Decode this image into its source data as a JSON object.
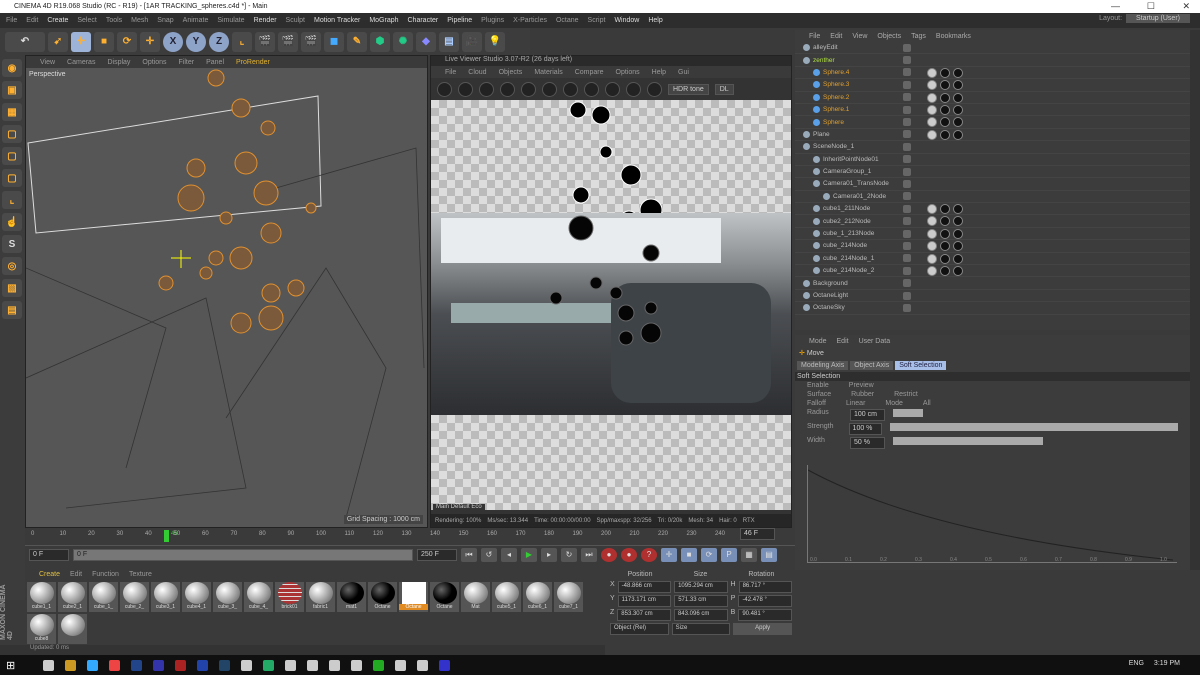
{
  "window": {
    "title": "CINEMA 4D R19.068 Studio (RC - R19) - [1AR TRACKING_spheres.c4d *] - Main",
    "min": "—",
    "max": "☐",
    "close": "✕"
  },
  "menu": [
    "File",
    "Edit",
    "Create",
    "Select",
    "Tools",
    "Mesh",
    "Snap",
    "Animate",
    "Simulate",
    "Render",
    "Sculpt",
    "Motion Tracker",
    "MoGraph",
    "Character",
    "Pipeline",
    "Plugins",
    "X-Particles",
    "Octane",
    "Script",
    "Window",
    "Help"
  ],
  "layout": {
    "label": "Layout:",
    "value": "Startup (User)"
  },
  "toolbar": {
    "x": "X",
    "y": "Y",
    "z": "Z"
  },
  "viewport": {
    "menu": [
      "View",
      "Cameras",
      "Display",
      "Options",
      "Filter",
      "Panel",
      "ProRender"
    ],
    "label": "Perspective",
    "grid_spacing": "Grid Spacing : 1000 cm"
  },
  "render_viewer": {
    "title": "Live Viewer Studio 3.07-R2 (26 days left)",
    "menu": [
      "File",
      "Cloud",
      "Objects",
      "Materials",
      "Compare",
      "Options",
      "Help",
      "Gui"
    ],
    "mode": "HDR tone",
    "channel": "DL",
    "tab": "Main Default Eco",
    "status": [
      "Rendering: 100%",
      "Ms/sec: 13.344",
      "Time: 00:00:00/00:00",
      "Spp/maxspp: 32/256",
      "Tri: 0/20k",
      "Mesh: 34",
      "Hair: 0",
      "RTX"
    ]
  },
  "timeline": {
    "ticks": [
      "0",
      "10",
      "20",
      "30",
      "40",
      "50",
      "60",
      "70",
      "80",
      "90",
      "100",
      "110",
      "120",
      "130",
      "140",
      "150",
      "160",
      "170",
      "180",
      "190",
      "200",
      "210",
      "220",
      "230",
      "240"
    ],
    "current": "46",
    "start": "0 F",
    "range_start": "0 F",
    "range_end": "250 F",
    "end": "250 F",
    "fps_field": "46 F"
  },
  "materials": {
    "menu": [
      "Create",
      "Edit",
      "Function",
      "Texture"
    ],
    "items": [
      "cube1_1",
      "cube2_1",
      "cube_1_",
      "cube_2_",
      "cube3_1",
      "cube4_1",
      "cube_3_",
      "cube_4_",
      "brick01",
      "fabric1",
      "mat1",
      "Octane",
      "Octane",
      "Octane",
      "Mat",
      "cube5_1",
      "cube6_1",
      "cube7_1",
      "cube8"
    ],
    "selected": 12
  },
  "brand": "MAXON CINEMA 4D",
  "coords": {
    "headers": [
      "Position",
      "Size",
      "Rotation"
    ],
    "rows": [
      {
        "axis": "X",
        "pos": "-48.866 cm",
        "size": "1095.294 cm",
        "rot_axis": "H",
        "rot": "86.717 °"
      },
      {
        "axis": "Y",
        "pos": "1173.171 cm",
        "size": "571.33 cm",
        "rot_axis": "P",
        "rot": "-42.478 °"
      },
      {
        "axis": "Z",
        "pos": "853.307 cm",
        "size": "843.096 cm",
        "rot_axis": "B",
        "rot": "90.481 °"
      }
    ],
    "mode": "Object (Rel)",
    "size_mode": "Size",
    "apply": "Apply"
  },
  "objects": {
    "menu": [
      "File",
      "Edit",
      "View",
      "Objects",
      "Tags",
      "Bookmarks"
    ],
    "items": [
      {
        "name": "alleyEdit",
        "c": "",
        "i": 0
      },
      {
        "name": "zenther",
        "c": "green",
        "i": 0
      },
      {
        "name": "Sphere.4",
        "c": "orange",
        "i": 1
      },
      {
        "name": "Sphere.3",
        "c": "orange",
        "i": 1
      },
      {
        "name": "Sphere.2",
        "c": "orange",
        "i": 1
      },
      {
        "name": "Sphere.1",
        "c": "orange",
        "i": 1
      },
      {
        "name": "Sphere",
        "c": "orange",
        "i": 1
      },
      {
        "name": "Plane",
        "c": "",
        "i": 0
      },
      {
        "name": "SceneNode_1",
        "c": "",
        "i": 0
      },
      {
        "name": "InheritPointNode01",
        "c": "",
        "i": 1
      },
      {
        "name": "CameraGroup_1",
        "c": "",
        "i": 1
      },
      {
        "name": "Camera01_TransNode",
        "c": "",
        "i": 1
      },
      {
        "name": "Camera01_2Node",
        "c": "",
        "i": 2
      },
      {
        "name": "cube1_211Node",
        "c": "",
        "i": 1
      },
      {
        "name": "cube2_212Node",
        "c": "",
        "i": 1
      },
      {
        "name": "cube_1_213Node",
        "c": "",
        "i": 1
      },
      {
        "name": "cube_214Node",
        "c": "",
        "i": 1
      },
      {
        "name": "cube_214Node_1",
        "c": "",
        "i": 1
      },
      {
        "name": "cube_214Node_2",
        "c": "",
        "i": 1
      },
      {
        "name": "Background",
        "c": "",
        "i": 0
      },
      {
        "name": "OctaneLight",
        "c": "",
        "i": 0
      },
      {
        "name": "OctaneSky",
        "c": "",
        "i": 0
      }
    ]
  },
  "attributes": {
    "menu": [
      "Mode",
      "Edit",
      "User Data"
    ],
    "object": "Move",
    "tabs": [
      "Modeling Axis",
      "Object Axis",
      "Soft Selection"
    ],
    "section": "Soft Selection",
    "row1": [
      "Enable",
      "Preview"
    ],
    "row2": [
      "Surface",
      "Rubber",
      "Restrict"
    ],
    "row3": [
      "Falloff",
      "Linear",
      "Mode",
      "All"
    ],
    "sliders": [
      {
        "label": "Radius",
        "value": "100 cm",
        "fraction": 0.1
      },
      {
        "label": "Strength",
        "value": "100 %",
        "fraction": 1.0
      },
      {
        "label": "Width",
        "value": "50 %",
        "fraction": 0.5
      }
    ],
    "graph_ticks": [
      "0.0",
      "0.1",
      "0.2",
      "0.3",
      "0.4",
      "0.5",
      "0.6",
      "0.7",
      "0.8",
      "0.9",
      "1.0"
    ]
  },
  "status": "Updated: 0 ms",
  "tray": {
    "lang": "ENG",
    "time": "3:19 PM"
  }
}
